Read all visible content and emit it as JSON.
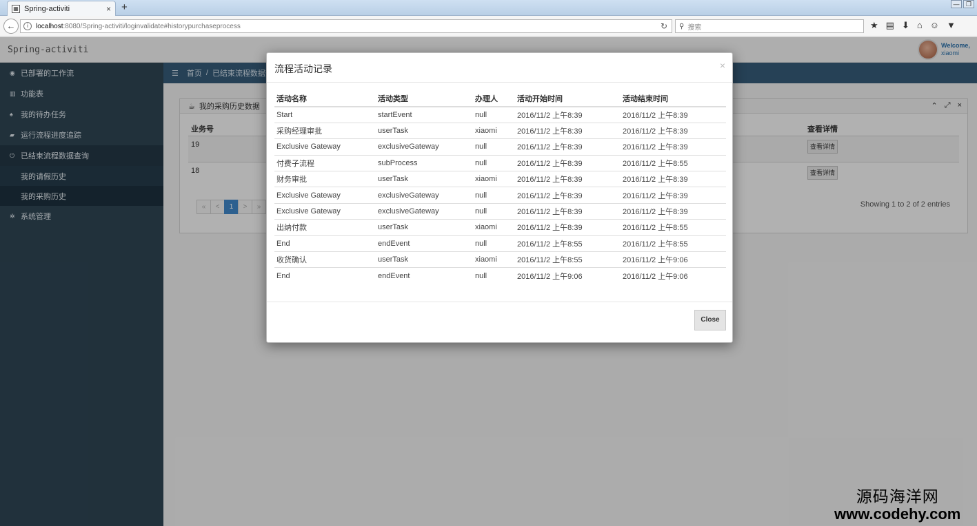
{
  "browser": {
    "tab_title": "Spring-activiti",
    "tab_close": "×",
    "new_tab": "+",
    "url_host": "localhost",
    "url_rest": ":8080/Spring-activiti/loginvalidate#historypurchaseprocess",
    "search_placeholder": "搜索",
    "toolbar_icons": [
      "★",
      "▤",
      "⬇",
      "⌂",
      "☺",
      "▼"
    ]
  },
  "app": {
    "brand": "Spring-activiti",
    "welcome": "Welcome,",
    "username": "xiaomi"
  },
  "sidebar": {
    "items": [
      {
        "icon": "◉",
        "label": "已部署的工作流"
      },
      {
        "icon": "▥",
        "label": "功能表"
      },
      {
        "icon": "♠",
        "label": "我的待办任务"
      },
      {
        "icon": "▰",
        "label": "运行流程进度追踪"
      },
      {
        "icon": "⏻",
        "label": "已结束流程数据查询"
      }
    ],
    "subitems": [
      {
        "label": "我的请假历史"
      },
      {
        "label": "我的采购历史"
      }
    ],
    "last": {
      "icon": "✲",
      "label": "系统管理"
    }
  },
  "breadcrumb": {
    "menu_icon": "☰",
    "home": "首页",
    "sep": "/",
    "current": "已结束流程数据查询"
  },
  "box": {
    "title": "我的采购历史数据",
    "tools": [
      "⌃",
      "⤢",
      "×"
    ],
    "col_id": "业务号",
    "col_detail": "查看详情",
    "rows": [
      {
        "id": "19",
        "btn": "查看详情"
      },
      {
        "id": "18",
        "btn": "查看详情"
      }
    ],
    "pager": [
      "«",
      "<",
      "1",
      ">",
      "»"
    ],
    "showing": "Showing 1 to 2 of 2 entries"
  },
  "modal": {
    "title": "流程活动记录",
    "close_x": "×",
    "columns": [
      "活动名称",
      "活动类型",
      "办理人",
      "活动开始时间",
      "活动结束时间"
    ],
    "rows": [
      [
        "Start",
        "startEvent",
        "null",
        "2016/11/2 上午8:39",
        "2016/11/2 上午8:39"
      ],
      [
        "采购经理审批",
        "userTask",
        "xiaomi",
        "2016/11/2 上午8:39",
        "2016/11/2 上午8:39"
      ],
      [
        "Exclusive Gateway",
        "exclusiveGateway",
        "null",
        "2016/11/2 上午8:39",
        "2016/11/2 上午8:39"
      ],
      [
        "付费子流程",
        "subProcess",
        "null",
        "2016/11/2 上午8:39",
        "2016/11/2 上午8:55"
      ],
      [
        "财务审批",
        "userTask",
        "xiaomi",
        "2016/11/2 上午8:39",
        "2016/11/2 上午8:39"
      ],
      [
        "Exclusive Gateway",
        "exclusiveGateway",
        "null",
        "2016/11/2 上午8:39",
        "2016/11/2 上午8:39"
      ],
      [
        "Exclusive Gateway",
        "exclusiveGateway",
        "null",
        "2016/11/2 上午8:39",
        "2016/11/2 上午8:39"
      ],
      [
        "出纳付款",
        "userTask",
        "xiaomi",
        "2016/11/2 上午8:39",
        "2016/11/2 上午8:55"
      ],
      [
        "End",
        "endEvent",
        "null",
        "2016/11/2 上午8:55",
        "2016/11/2 上午8:55"
      ],
      [
        "收货确认",
        "userTask",
        "xiaomi",
        "2016/11/2 上午8:55",
        "2016/11/2 上午9:06"
      ],
      [
        "End",
        "endEvent",
        "null",
        "2016/11/2 上午9:06",
        "2016/11/2 上午9:06"
      ]
    ],
    "close_button": "Close"
  },
  "watermark": {
    "line1": "源码海洋网",
    "line2": "www.codehy.com"
  }
}
